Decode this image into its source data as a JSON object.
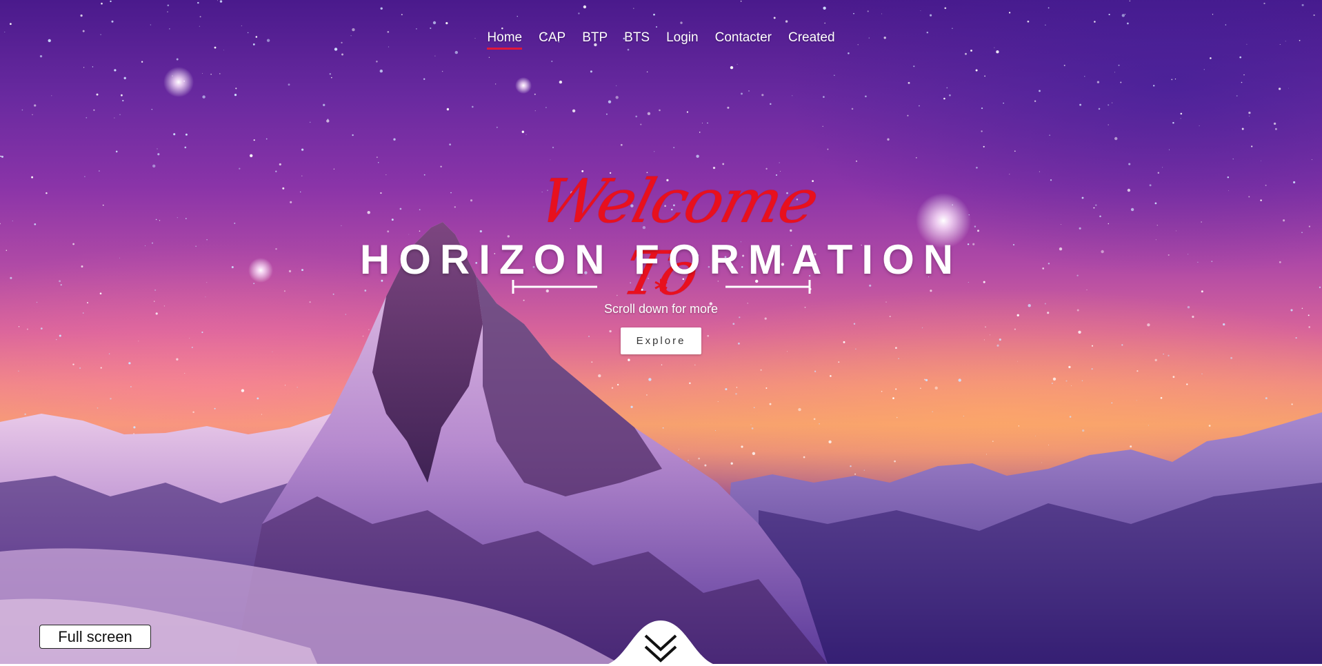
{
  "nav": {
    "items": [
      {
        "label": "Home",
        "active": true
      },
      {
        "label": "CAP",
        "active": false
      },
      {
        "label": "BTP",
        "active": false
      },
      {
        "label": "BTS",
        "active": false
      },
      {
        "label": "Login",
        "active": false
      },
      {
        "label": "Contacter",
        "active": false
      },
      {
        "label": "Created",
        "active": false
      }
    ]
  },
  "hero": {
    "welcome": "Welcome To",
    "brand": "HORIZON FORMATION",
    "divider_mark": "*",
    "subtitle": "Scroll down for more",
    "explore_label": "Explore"
  },
  "controls": {
    "fullscreen_label": "Full screen",
    "scroll_down_icon": "chevron-double-down-icon"
  },
  "colors": {
    "accent_red": "#e8101e",
    "nav_underline": "#e0183a",
    "text_white": "#ffffff",
    "sky_purple": "#6a2aa0",
    "sunset_orange": "#f6a070"
  }
}
